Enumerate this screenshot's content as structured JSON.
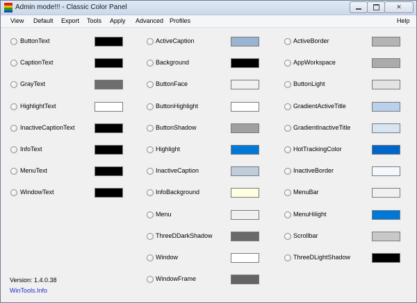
{
  "window": {
    "title": "Admin mode!!! - Classic Color Panel",
    "icon": "app-icon",
    "controls": {
      "minimize_icon": "minimize-icon",
      "maximize_icon": "maximize-icon",
      "close_icon": "close-icon",
      "close_glyph": "✕"
    }
  },
  "menu": {
    "items": [
      "View",
      "Default",
      "Export",
      "Tools",
      "Apply",
      "Advanced",
      "Profiles"
    ],
    "help": "Help"
  },
  "colors": {
    "col1": [
      {
        "name": "ButtonText",
        "color": "#000000"
      },
      {
        "name": "CaptionText",
        "color": "#000000"
      },
      {
        "name": "GrayText",
        "color": "#6d6d6d"
      },
      {
        "name": "HighlightText",
        "color": "#ffffff"
      },
      {
        "name": "InactiveCaptionText",
        "color": "#000000"
      },
      {
        "name": "InfoText",
        "color": "#000000"
      },
      {
        "name": "MenuText",
        "color": "#000000"
      },
      {
        "name": "WindowText",
        "color": "#000000"
      }
    ],
    "col2": [
      {
        "name": "ActiveCaption",
        "color": "#99b4d1"
      },
      {
        "name": "Background",
        "color": "#000000"
      },
      {
        "name": "ButtonFace",
        "color": "#f0f0f0"
      },
      {
        "name": "ButtonHighlight",
        "color": "#ffffff"
      },
      {
        "name": "ButtonShadow",
        "color": "#a0a0a0"
      },
      {
        "name": "Highlight",
        "color": "#0078d7"
      },
      {
        "name": "InactiveCaption",
        "color": "#bfcddb"
      },
      {
        "name": "InfoBackground",
        "color": "#ffffe1"
      },
      {
        "name": "Menu",
        "color": "#f0f0f0"
      },
      {
        "name": "ThreeDDarkShadow",
        "color": "#696969"
      },
      {
        "name": "Window",
        "color": "#ffffff"
      },
      {
        "name": "WindowFrame",
        "color": "#646464"
      }
    ],
    "col3": [
      {
        "name": "ActiveBorder",
        "color": "#b4b4b4"
      },
      {
        "name": "AppWorkspace",
        "color": "#ababab"
      },
      {
        "name": "ButtonLight",
        "color": "#e3e3e3"
      },
      {
        "name": "GradientActiveTitle",
        "color": "#b9d1ea"
      },
      {
        "name": "GradientInactiveTitle",
        "color": "#d7e4f2"
      },
      {
        "name": "HotTrackingColor",
        "color": "#0066cc"
      },
      {
        "name": "InactiveBorder",
        "color": "#f4f7fc"
      },
      {
        "name": "MenuBar",
        "color": "#f0f0f0"
      },
      {
        "name": "MenuHilight",
        "color": "#0078d7"
      },
      {
        "name": "Scrollbar",
        "color": "#c8c8c8"
      },
      {
        "name": "ThreeDLightShadow",
        "color": "#000000"
      }
    ]
  },
  "footer": {
    "version": "Version: 1.4.0.38",
    "link": "WinTools.Info"
  }
}
